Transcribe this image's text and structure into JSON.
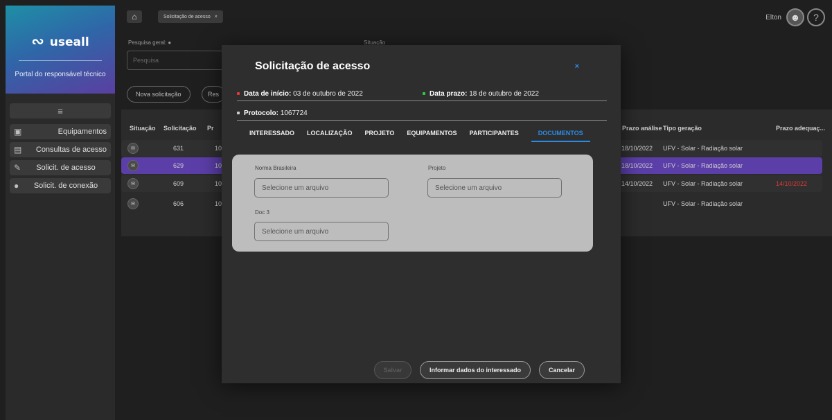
{
  "sidebar": {
    "brand": "useall",
    "subtitle": "Portal do responsável técnico",
    "items": [
      {
        "label": "Equipamentos"
      },
      {
        "label": "Consultas de acesso"
      },
      {
        "label": "Solicit. de acesso"
      },
      {
        "label": "Solicit. de conexão"
      }
    ]
  },
  "topbar": {
    "tab_label": "Solicitação de acesso",
    "tab_close": "×",
    "user_name": "Elton",
    "help": "?"
  },
  "filters": {
    "search_label": "Pesquisa geral:",
    "search_placeholder": "Pesquisa",
    "situation_label": "Situação",
    "new_button": "Nova solicitação",
    "reset_button": "Res"
  },
  "table": {
    "headers": {
      "situacao": "Situação",
      "solicitacao": "Solicitação",
      "pr": "Pr",
      "prazo_analise": "Prazo análise",
      "tipo_geracao": "Tipo geração",
      "prazo_adequacao": "Prazo adequaç..."
    },
    "rows": [
      {
        "solicitacao": "631",
        "pr": "10",
        "prazo_analise": "18/10/2022",
        "tipo": "UFV - Solar - Radiação solar",
        "adequacao": ""
      },
      {
        "solicitacao": "629",
        "pr": "10",
        "prazo_analise": "18/10/2022",
        "tipo": "UFV - Solar - Radiação solar",
        "adequacao": ""
      },
      {
        "solicitacao": "609",
        "pr": "10",
        "prazo_analise": "14/10/2022",
        "tipo": "UFV - Solar - Radiação solar",
        "adequacao": "14/10/2022"
      },
      {
        "solicitacao": "606",
        "pr": "10",
        "prazo_analise": "",
        "tipo": "UFV - Solar - Radiação solar",
        "adequacao": ""
      }
    ]
  },
  "modal": {
    "title": "Solicitação de acesso",
    "close": "×",
    "start_label": "Data de início:",
    "start_value": "03 de outubro de 2022",
    "deadline_label": "Data prazo:",
    "deadline_value": "18 de outubro de 2022",
    "protocol_label": "Protocolo:",
    "protocol_value": "1067724",
    "tabs": [
      "INTERESSADO",
      "LOCALIZAÇÃO",
      "PROJETO",
      "EQUIPAMENTOS",
      "PARTICIPANTES",
      "DOCUMENTOS"
    ],
    "active_tab": "DOCUMENTOS",
    "fields": [
      {
        "label": "Norma Brasileira",
        "placeholder": "Selecione um arquivo"
      },
      {
        "label": "Projeto",
        "placeholder": "Selecione um arquivo"
      },
      {
        "label": "Doc 3",
        "placeholder": "Selecione um arquivo"
      }
    ],
    "buttons": {
      "save": "Salvar",
      "inform": "Informar dados do interessado",
      "cancel": "Cancelar"
    }
  },
  "colors": {
    "accent": "#2b8be8",
    "selected_row": "#5b3ea8",
    "start_dot": "#e53935",
    "deadline_dot": "#2ecc40",
    "overdue": "#e03a3a"
  }
}
